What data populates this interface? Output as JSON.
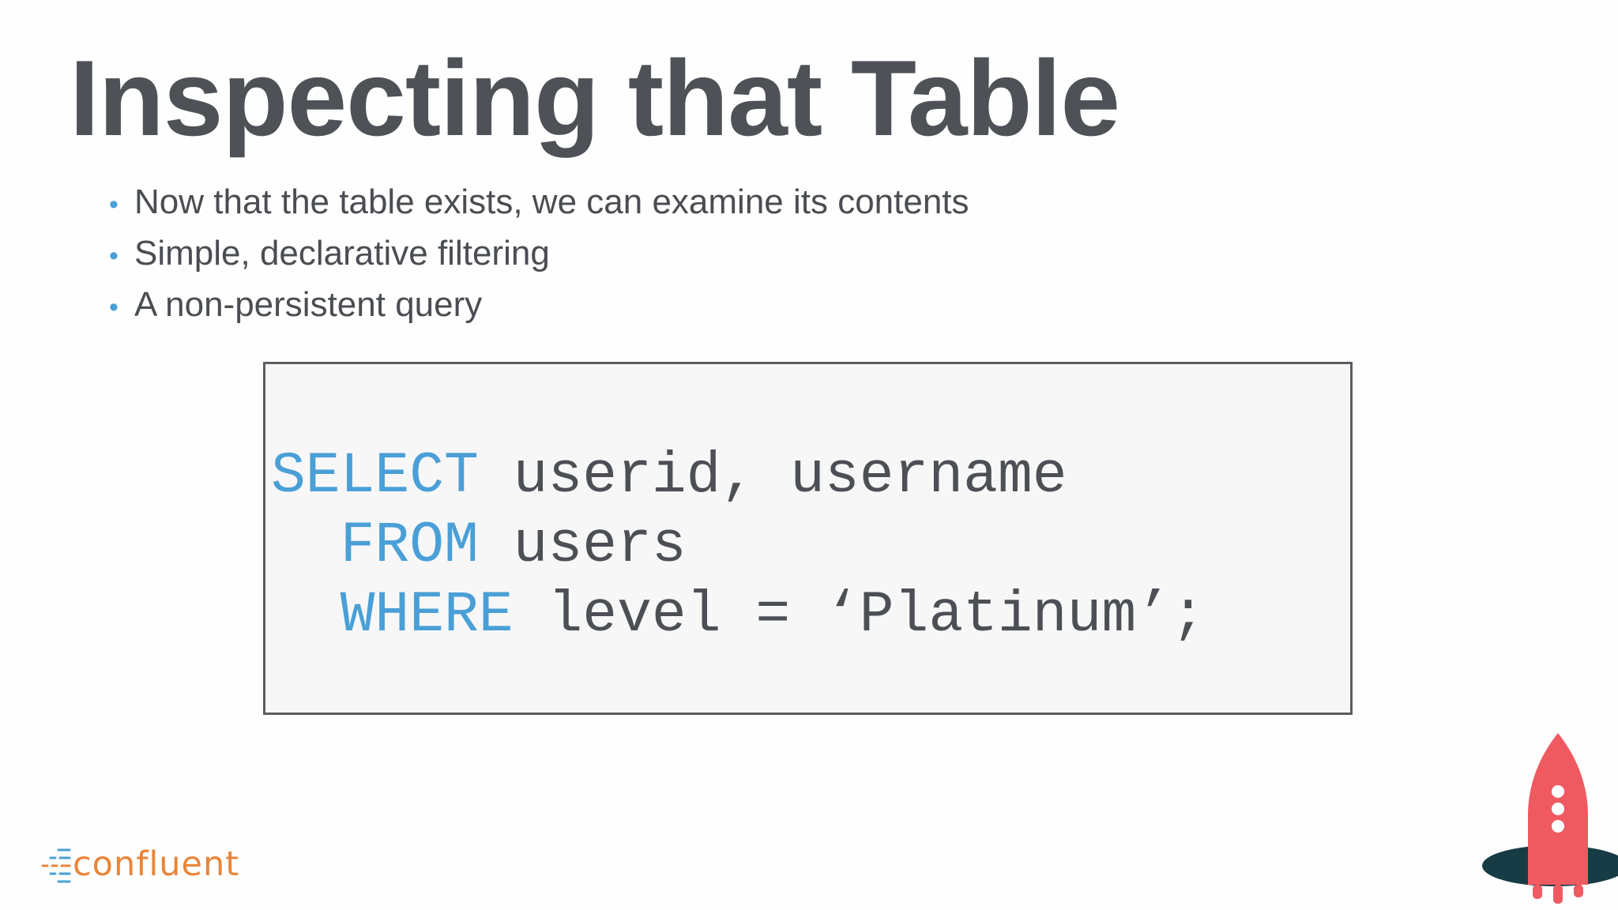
{
  "slide": {
    "title": "Inspecting that Table",
    "bullets": [
      "Now that the table exists, we can examine its contents",
      "Simple, declarative filtering",
      "A non-persistent query"
    ],
    "code": {
      "line1_keyword": "SELECT",
      "line1_rest": " userid, username",
      "line2_keyword": "FROM",
      "line2_rest": " users",
      "line3_keyword": "WHERE",
      "line3_rest": " level = ‘Platinum’;"
    },
    "logo": {
      "wordmark": "confluent"
    }
  },
  "colors": {
    "title": "#4e5257",
    "body_text": "#4a4d52",
    "accent_blue": "#4a9fd6",
    "logo_orange": "#e9853a",
    "rocket_red": "#ef5a61",
    "rocket_base": "#173c46"
  },
  "icons": {
    "rocket": "rocket-icon",
    "logo_mark": "confluent-logo-mark-icon"
  }
}
